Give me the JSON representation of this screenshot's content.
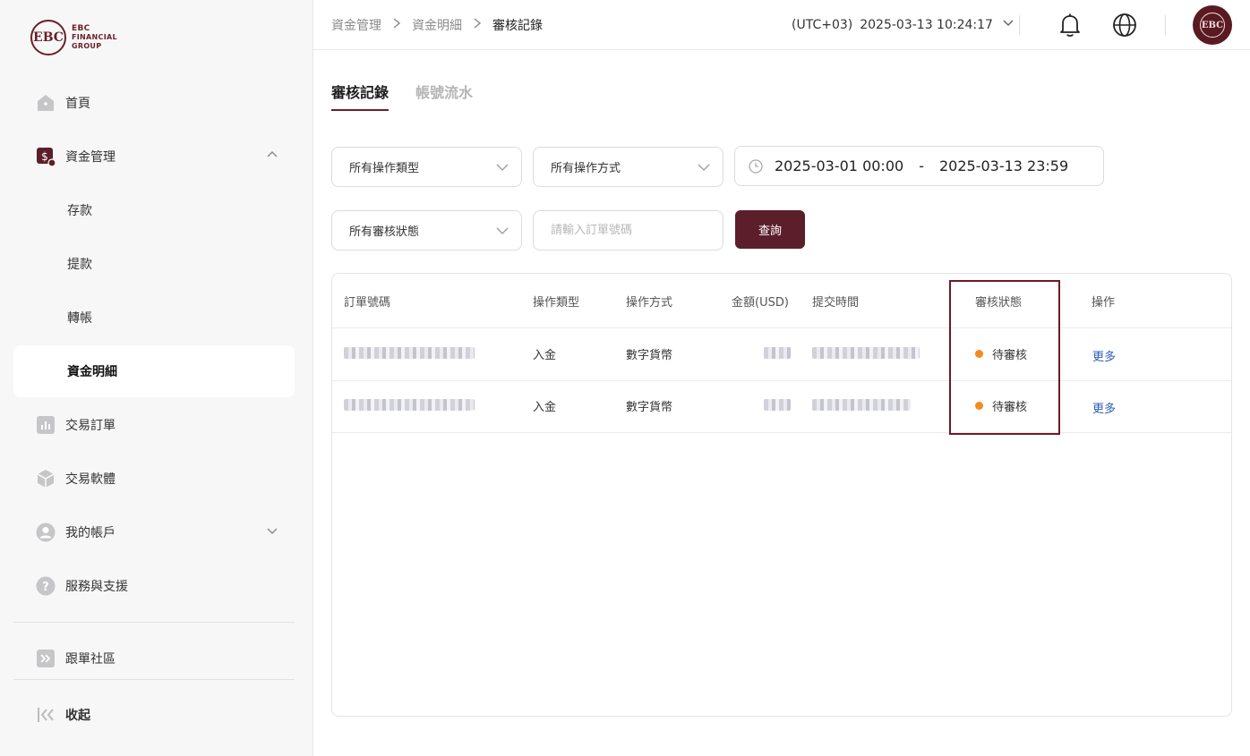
{
  "logo": {
    "mark": "EBC",
    "line1": "EBC",
    "line2": "FINANCIAL",
    "line3": "GROUP"
  },
  "sidebar": {
    "items": [
      {
        "label": "首頁",
        "icon": "home-icon"
      },
      {
        "label": "資金管理",
        "icon": "funds-icon",
        "expanded": true
      },
      {
        "label": "存款"
      },
      {
        "label": "提款"
      },
      {
        "label": "轉帳"
      },
      {
        "label": "資金明細",
        "active": true
      },
      {
        "label": "交易訂單",
        "icon": "chart-icon"
      },
      {
        "label": "交易軟體",
        "icon": "box-icon"
      },
      {
        "label": "我的帳戶",
        "icon": "user-icon"
      },
      {
        "label": "服務與支援",
        "icon": "help-icon"
      },
      {
        "label": "跟單社區",
        "icon": "forward-icon"
      },
      {
        "label": "收起",
        "icon": "collapse-icon"
      }
    ]
  },
  "header": {
    "breadcrumb": [
      "資金管理",
      "資金明細",
      "審核記錄"
    ],
    "timezone": "(UTC+03)",
    "datetime": "2025-03-13 10:24:17",
    "avatar_text": "EBC"
  },
  "tabs": [
    {
      "label": "審核記錄",
      "active": true
    },
    {
      "label": "帳號流水",
      "active": false
    }
  ],
  "filters": {
    "operation_type": "所有操作類型",
    "operation_method": "所有操作方式",
    "date_start": "2025-03-01 00:00",
    "date_separator": "-",
    "date_end": "2025-03-13 23:59",
    "review_status": "所有審核狀態",
    "order_placeholder": "請輸入訂單號碼",
    "query_label": "查詢"
  },
  "table": {
    "columns": [
      "訂單號碼",
      "操作類型",
      "操作方式",
      "金額(USD)",
      "提交時間",
      "審核狀態",
      "操作"
    ],
    "rows": [
      {
        "type": "入金",
        "method": "數字貨幣",
        "status": "待審核",
        "action": "更多"
      },
      {
        "type": "入金",
        "method": "數字貨幣",
        "status": "待審核",
        "action": "更多"
      }
    ]
  },
  "colors": {
    "brand": "#5c1e2b",
    "pending": "#f7891e",
    "link": "#2a5cb8",
    "highlight": "#6e1a24"
  }
}
